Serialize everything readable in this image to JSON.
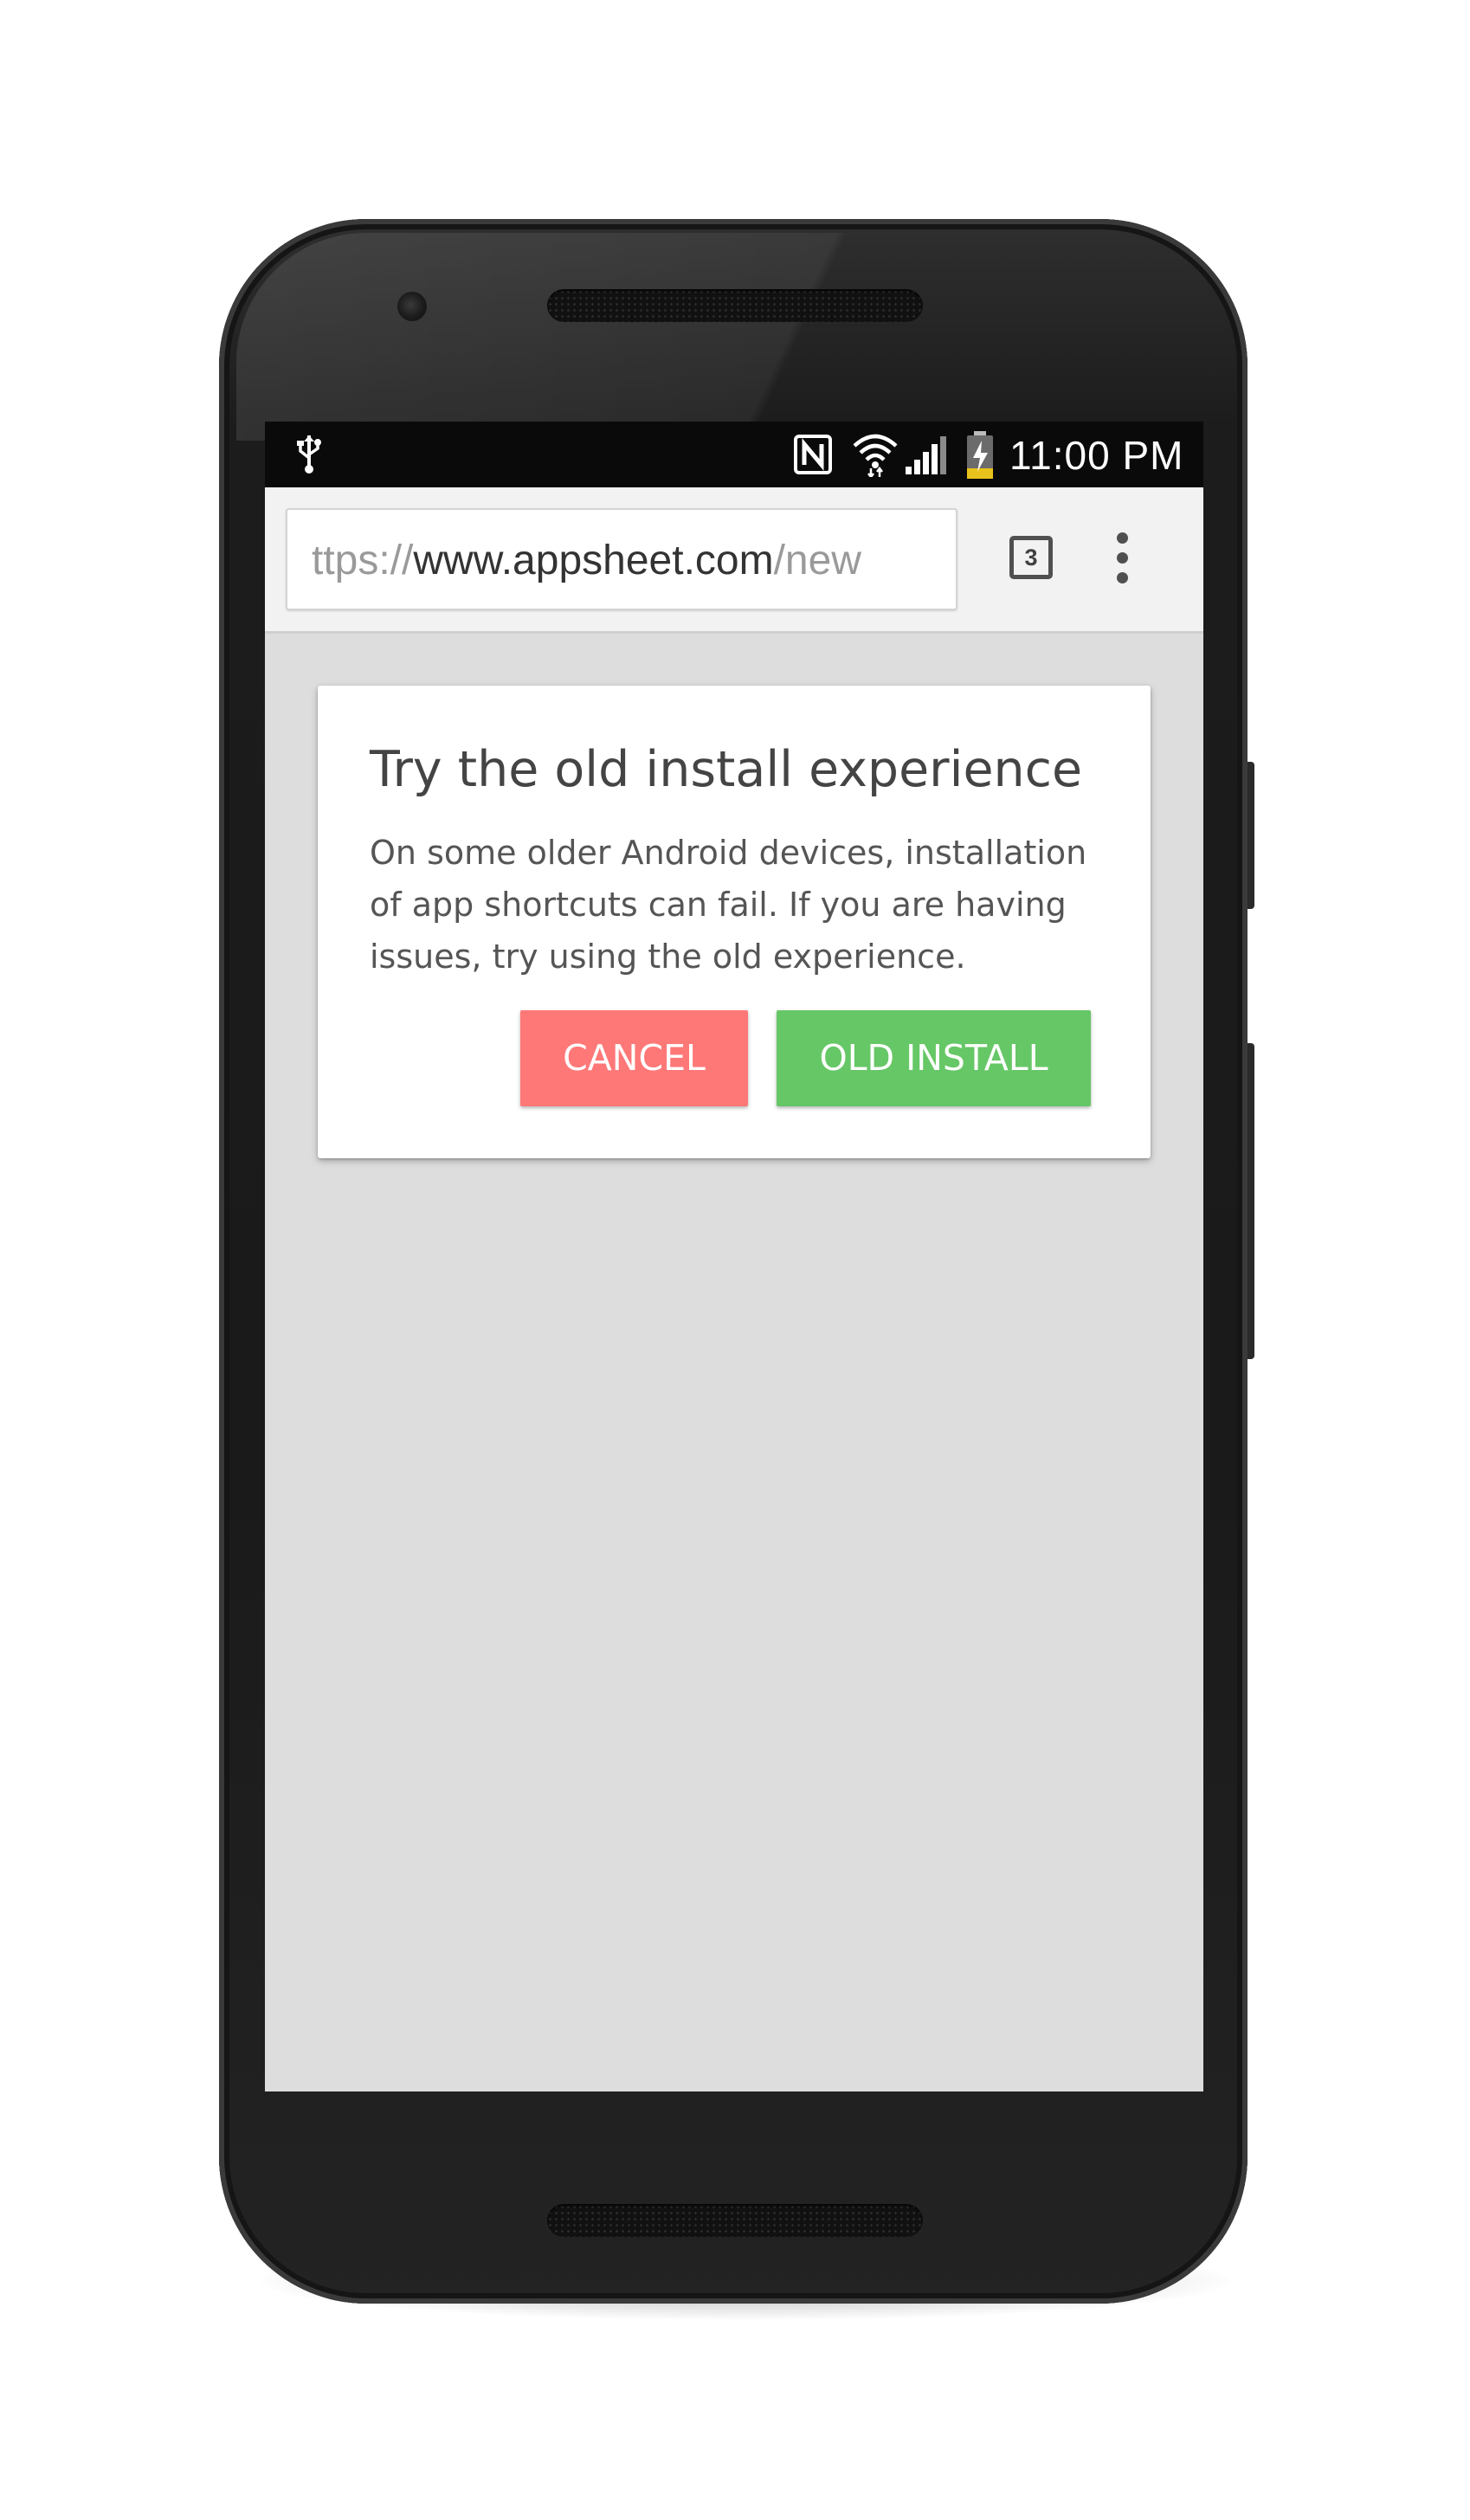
{
  "status_bar": {
    "time": "11:00 PM",
    "icons": [
      "usb-icon",
      "nfc-icon",
      "wifi-icon",
      "signal-icon",
      "battery-charging-icon"
    ]
  },
  "browser": {
    "url": {
      "scheme_fragment": "ttps://",
      "host": "www.appsheet.com",
      "path_fragment": "/new"
    },
    "tab_count": "3",
    "menu_icon": "overflow-menu-icon"
  },
  "dialog": {
    "title": "Try the old install experience",
    "body": "On some older Android devices, installation of app shortcuts can fail. If you are having issues, try using the old experience.",
    "cancel_label": "CANCEL",
    "confirm_label": "OLD INSTALL"
  },
  "colors": {
    "cancel_button": "#ff7878",
    "confirm_button": "#66c766",
    "page_background": "#dddddd",
    "toolbar_background": "#f2f2f2"
  }
}
